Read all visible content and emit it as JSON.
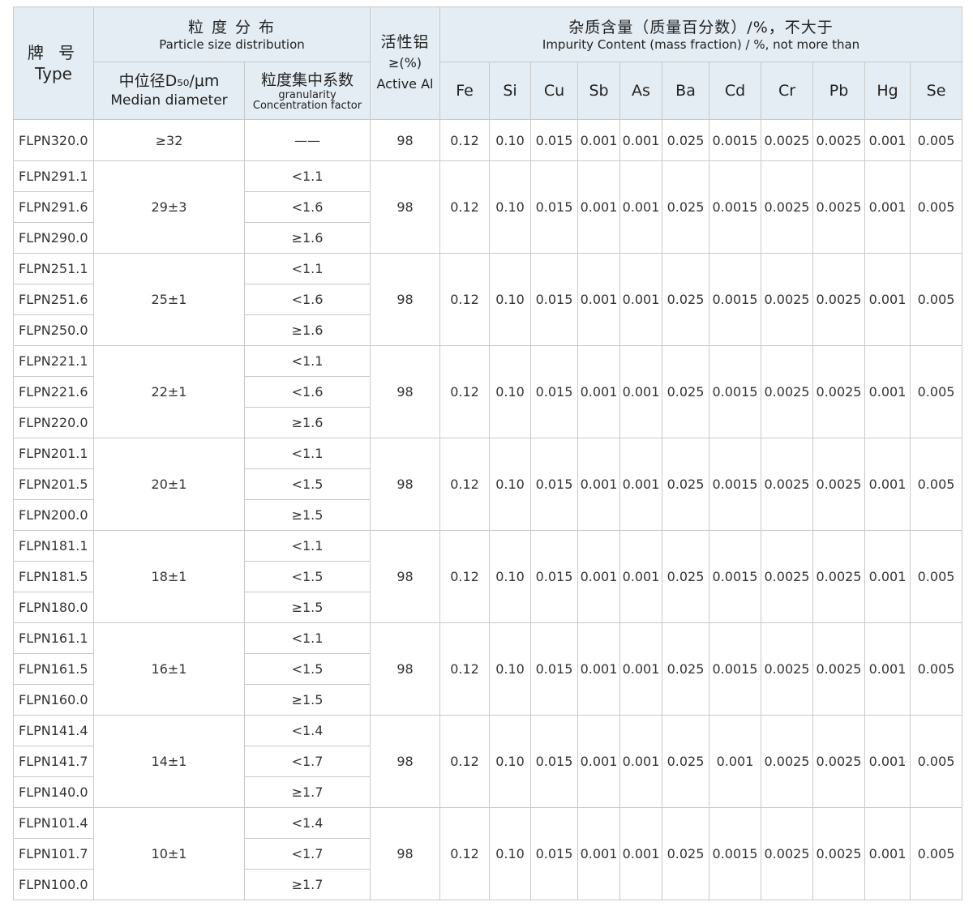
{
  "header": {
    "type_cn": "牌 号",
    "type_en": "Type",
    "psd_cn": "粒 度 分 布",
    "psd_en": "Particle size distribution",
    "median_cn": "中位径D₅₀/μm",
    "median_en": "Median diameter",
    "conc_cn": "粒度集中系数",
    "conc_en1": "granularity",
    "conc_en2": "Concentration factor",
    "active_cn": "活性铝",
    "active_sym": "≥(%)",
    "active_en": "Active Al",
    "impurity_cn": "杂质含量（质量百分数）/%，不大于",
    "impurity_en": "Impurity Content (mass fraction) / %, not more than",
    "elements": [
      "Fe",
      "Si",
      "Cu",
      "Sb",
      "As",
      "Ba",
      "Cd",
      "Cr",
      "Pb",
      "Hg",
      "Se"
    ]
  },
  "groups": [
    {
      "median": "≥32",
      "active": "98",
      "impurities": [
        "0.12",
        "0.10",
        "0.015",
        "0.001",
        "0.001",
        "0.025",
        "0.0015",
        "0.0025",
        "0.0025",
        "0.001",
        "0.005"
      ],
      "rows": [
        {
          "type": "FLPN320.0",
          "conc": "——"
        }
      ]
    },
    {
      "median": "29±3",
      "active": "98",
      "impurities": [
        "0.12",
        "0.10",
        "0.015",
        "0.001",
        "0.001",
        "0.025",
        "0.0015",
        "0.0025",
        "0.0025",
        "0.001",
        "0.005"
      ],
      "rows": [
        {
          "type": "FLPN291.1",
          "conc": "<1.1"
        },
        {
          "type": "FLPN291.6",
          "conc": "<1.6"
        },
        {
          "type": "FLPN290.0",
          "conc": "≥1.6"
        }
      ]
    },
    {
      "median": "25±1",
      "active": "98",
      "impurities": [
        "0.12",
        "0.10",
        "0.015",
        "0.001",
        "0.001",
        "0.025",
        "0.0015",
        "0.0025",
        "0.0025",
        "0.001",
        "0.005"
      ],
      "rows": [
        {
          "type": "FLPN251.1",
          "conc": "<1.1"
        },
        {
          "type": "FLPN251.6",
          "conc": "<1.6"
        },
        {
          "type": "FLPN250.0",
          "conc": "≥1.6"
        }
      ]
    },
    {
      "median": "22±1",
      "active": "98",
      "impurities": [
        "0.12",
        "0.10",
        "0.015",
        "0.001",
        "0.001",
        "0.025",
        "0.0015",
        "0.0025",
        "0.0025",
        "0.001",
        "0.005"
      ],
      "rows": [
        {
          "type": "FLPN221.1",
          "conc": "<1.1"
        },
        {
          "type": "FLPN221.6",
          "conc": "<1.6"
        },
        {
          "type": "FLPN220.0",
          "conc": "≥1.6"
        }
      ]
    },
    {
      "median": "20±1",
      "active": "98",
      "impurities": [
        "0.12",
        "0.10",
        "0.015",
        "0.001",
        "0.001",
        "0.025",
        "0.0015",
        "0.0025",
        "0.0025",
        "0.001",
        "0.005"
      ],
      "rows": [
        {
          "type": "FLPN201.1",
          "conc": "<1.1"
        },
        {
          "type": "FLPN201.5",
          "conc": "<1.5"
        },
        {
          "type": "FLPN200.0",
          "conc": "≥1.5"
        }
      ]
    },
    {
      "median": "18±1",
      "active": "98",
      "impurities": [
        "0.12",
        "0.10",
        "0.015",
        "0.001",
        "0.001",
        "0.025",
        "0.0015",
        "0.0025",
        "0.0025",
        "0.001",
        "0.005"
      ],
      "rows": [
        {
          "type": "FLPN181.1",
          "conc": "<1.1"
        },
        {
          "type": "FLPN181.5",
          "conc": "<1.5"
        },
        {
          "type": "FLPN180.0",
          "conc": "≥1.5"
        }
      ]
    },
    {
      "median": "16±1",
      "active": "98",
      "impurities": [
        "0.12",
        "0.10",
        "0.015",
        "0.001",
        "0.001",
        "0.025",
        "0.0015",
        "0.0025",
        "0.0025",
        "0.001",
        "0.005"
      ],
      "rows": [
        {
          "type": "FLPN161.1",
          "conc": "<1.1"
        },
        {
          "type": "FLPN161.5",
          "conc": "<1.5"
        },
        {
          "type": "FLPN160.0",
          "conc": "≥1.5"
        }
      ]
    },
    {
      "median": "14±1",
      "active": "98",
      "impurities": [
        "0.12",
        "0.10",
        "0.015",
        "0.001",
        "0.001",
        "0.025",
        "0.001",
        "0.0025",
        "0.0025",
        "0.001",
        "0.005"
      ],
      "rows": [
        {
          "type": "FLPN141.4",
          "conc": "<1.4"
        },
        {
          "type": "FLPN141.7",
          "conc": "<1.7"
        },
        {
          "type": "FLPN140.0",
          "conc": "≥1.7"
        }
      ]
    },
    {
      "median": "10±1",
      "active": "98",
      "impurities": [
        "0.12",
        "0.10",
        "0.015",
        "0.001",
        "0.001",
        "0.025",
        "0.0015",
        "0.0025",
        "0.0025",
        "0.001",
        "0.005"
      ],
      "rows": [
        {
          "type": "FLPN101.4",
          "conc": "<1.4"
        },
        {
          "type": "FLPN101.7",
          "conc": "<1.7"
        },
        {
          "type": "FLPN100.0",
          "conc": "≥1.7"
        }
      ]
    }
  ]
}
